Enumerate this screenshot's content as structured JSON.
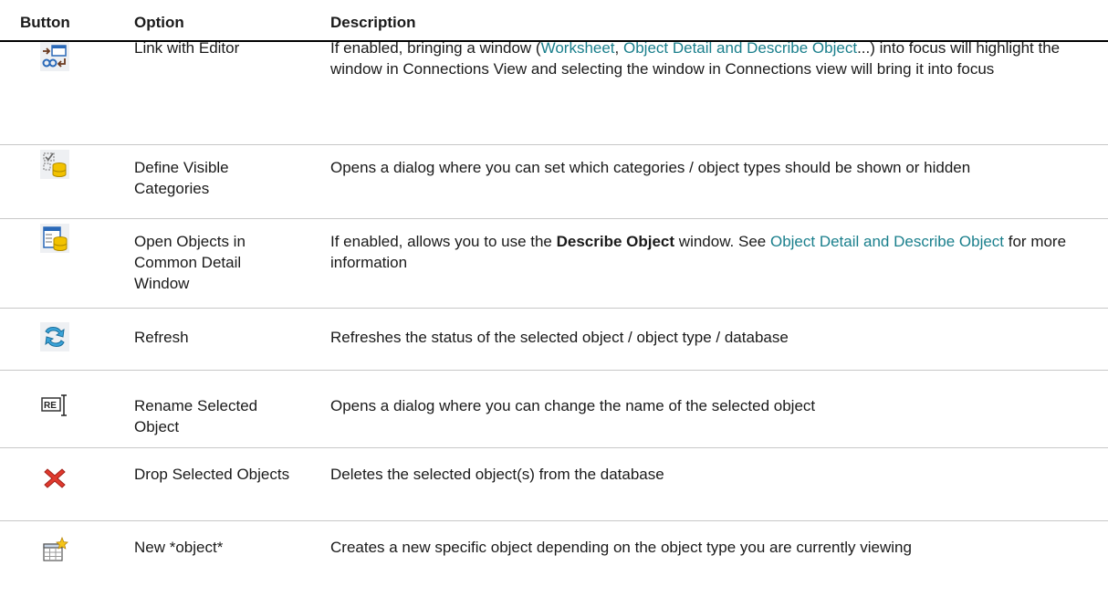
{
  "headers": {
    "button": "Button",
    "option": "Option",
    "description": "Description"
  },
  "colors": {
    "link": "#1a7f8c",
    "header_rule": "#000000",
    "row_rule": "#c8c8c8"
  },
  "rows": [
    {
      "icon": "link-with-editor-icon",
      "option": "Link with Editor",
      "desc": {
        "t1": "If enabled, bringing a window (",
        "l1": "Worksheet",
        "t2": ", ",
        "l2": "Object Detail and Describe Object",
        "t3": "...) into focus will highlight the window in Connections View and selecting the window in Connections view will bring it into focus"
      }
    },
    {
      "icon": "define-visible-categories-icon",
      "option": "Define Visible Categories",
      "desc": {
        "t1": "Opens a dialog where you can set which categories / object types should be shown or hidden"
      }
    },
    {
      "icon": "common-detail-window-icon",
      "option": "Open Objects in Common Detail Window",
      "desc": {
        "t1": "If enabled, allows you to use the ",
        "b1": "Describe Object",
        "t2": " window. See ",
        "l1": "Object Detail and Describe Object",
        "t3": " for more information"
      }
    },
    {
      "icon": "refresh-icon",
      "option": "Refresh",
      "desc": {
        "t1": "Refreshes the status of the selected object / object type / database"
      }
    },
    {
      "icon": "rename-icon",
      "option": "Rename Selected Object",
      "desc": {
        "t1": "Opens a dialog where you can change the name of the selected object"
      }
    },
    {
      "icon": "drop-icon",
      "option": "Drop Selected Objects",
      "desc": {
        "t1": "Deletes the selected object(s) from the database"
      }
    },
    {
      "icon": "new-object-icon",
      "option": "New *object*",
      "desc": {
        "t1": "Creates a new specific object depending on the object type you are currently viewing"
      }
    }
  ]
}
